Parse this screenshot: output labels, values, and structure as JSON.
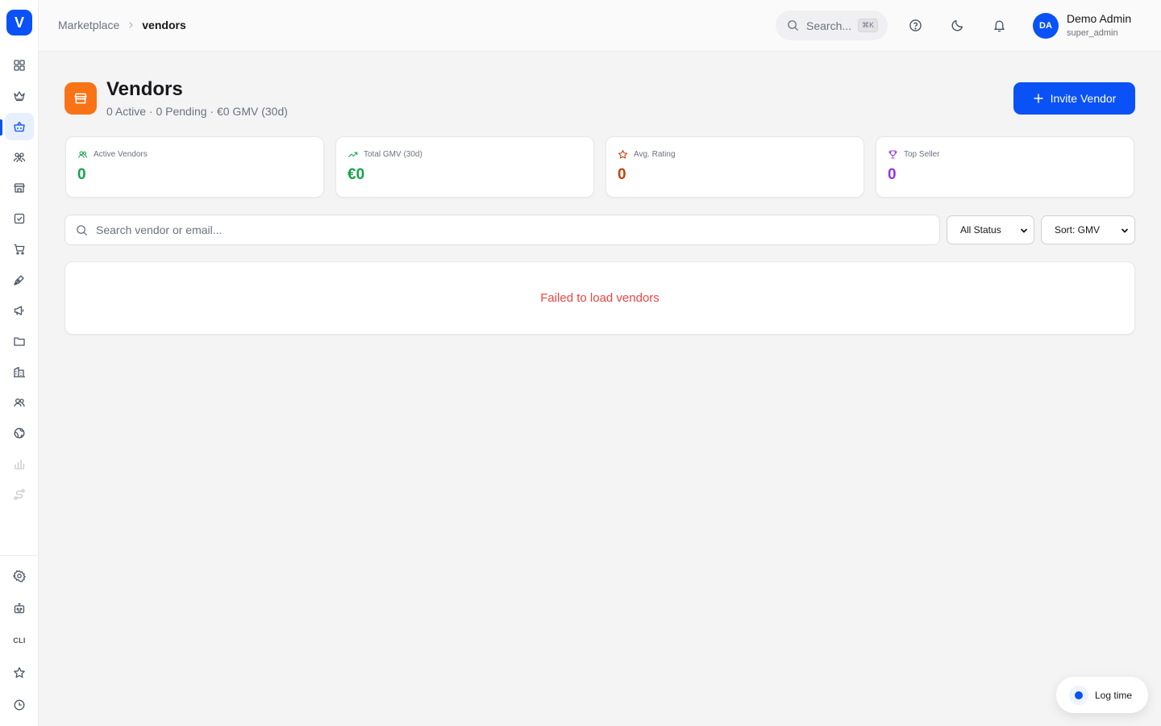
{
  "app": {
    "logo_letter": "V"
  },
  "breadcrumb": {
    "parent": "Marketplace",
    "current": "vendors"
  },
  "header": {
    "search_placeholder": "Search...",
    "search_shortcut": "⌘K",
    "user": {
      "initials": "DA",
      "name": "Demo Admin",
      "role": "super_admin"
    }
  },
  "sidebar": {
    "active_item": "marketplace",
    "items": [
      "dashboard",
      "crown",
      "marketplace",
      "community",
      "store",
      "tasks",
      "cart",
      "pen",
      "megaphone",
      "folder",
      "buildings",
      "people",
      "globe",
      "bar-chart",
      "workflow"
    ],
    "bottom_items": [
      "settings",
      "robot",
      "CLI",
      "favorites",
      "history"
    ],
    "cli_label": "CLI"
  },
  "page": {
    "title": "Vendors",
    "subtitle": "0 Active · 0 Pending · €0 GMV (30d)",
    "invite_button": "Invite Vendor"
  },
  "stats": [
    {
      "label": "Active Vendors",
      "value": "0",
      "color": "#16a34a",
      "icon": "users-icon"
    },
    {
      "label": "Total GMV (30d)",
      "value": "€0",
      "color": "#16a34a",
      "icon": "trending-up-icon"
    },
    {
      "label": "Avg. Rating",
      "value": "0",
      "color": "#c2410c",
      "icon": "star-icon"
    },
    {
      "label": "Top Seller",
      "value": "0",
      "color": "#9333ea",
      "icon": "trophy-icon"
    }
  ],
  "filters": {
    "search_placeholder": "Search vendor or email...",
    "status_selected": "All Status",
    "sort_selected": "Sort: GMV"
  },
  "error": {
    "message": "Failed to load vendors"
  },
  "log_time": {
    "label": "Log time"
  },
  "colors": {
    "primary": "#0a52f5",
    "page_icon": "#f97316",
    "error": "#ef4444"
  }
}
